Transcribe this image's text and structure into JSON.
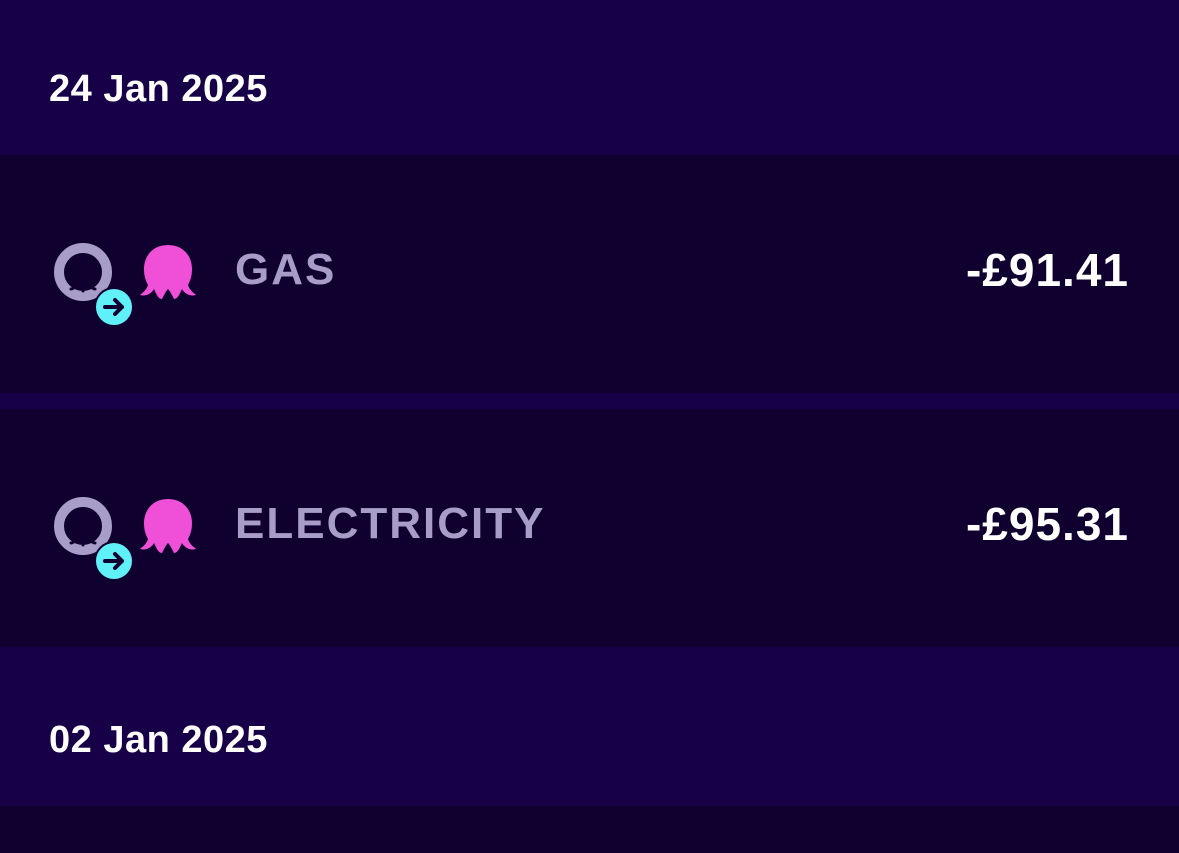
{
  "transactions_groups": [
    {
      "date": "24 Jan 2025",
      "items": [
        {
          "label": "GAS",
          "amount": "-£91.41"
        },
        {
          "label": "ELECTRICITY",
          "amount": "-£95.31"
        }
      ]
    },
    {
      "date": "02 Jan 2025",
      "items": []
    }
  ],
  "colors": {
    "background": "#180048",
    "row_background": "#100030",
    "label_text": "#a89cc8",
    "amount_text": "#ffffff",
    "account_icon": "#a89cc8",
    "arrow_badge": "#60f0f8",
    "octopus_icon": "#f050d8"
  },
  "icons": {
    "account": "octopus-account-ring-icon",
    "badge": "arrow-right-badge-icon",
    "supplier": "octopus-icon"
  }
}
